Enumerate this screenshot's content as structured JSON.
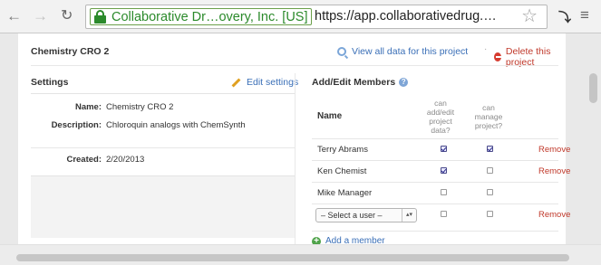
{
  "browser": {
    "ev_name": "Collaborative Dr…overy, Inc. [US]",
    "url": "https://app.collaborativedrug.…"
  },
  "page": {
    "project_title": "Chemistry CRO 2",
    "view_all_link": "View all data for this project",
    "delete_link": "Delete this project",
    "separator": "·"
  },
  "settings": {
    "title": "Settings",
    "edit_link": "Edit settings",
    "rows": [
      {
        "label": "Name:",
        "value": "Chemistry CRO 2"
      },
      {
        "label": "Description:",
        "value": "Chloroquin analogs with ChemSynth"
      },
      {
        "label": "Created:",
        "value": "2/20/2013"
      }
    ]
  },
  "members": {
    "title": "Add/Edit Members",
    "help_glyph": "?",
    "col_name": "Name",
    "col_edit_lines": [
      "can",
      "add/edit",
      "project",
      "data?"
    ],
    "col_manage_lines": [
      "can",
      "manage",
      "project?"
    ],
    "rows": [
      {
        "name": "Terry Abrams",
        "can_edit": true,
        "can_manage": true,
        "remove": "Remove"
      },
      {
        "name": "Ken Chemist",
        "can_edit": true,
        "can_manage": false,
        "remove": "Remove"
      },
      {
        "name": "Mike Manager",
        "can_edit": false,
        "can_manage": false,
        "remove": ""
      }
    ],
    "select_row": {
      "placeholder": "– Select a user –",
      "can_edit": false,
      "can_manage": false,
      "remove": "Remove"
    },
    "add_member": "Add a member",
    "add_glyph": "+"
  },
  "icons": {
    "back": "←",
    "forward": "→",
    "reload": "↻",
    "star": "☆",
    "menu": "≡",
    "extension": "⤵",
    "select_arrows": "▴▾"
  },
  "colors": {
    "link": "#3a6fb7",
    "danger": "#c0392b",
    "ev_green": "#2b8a2b"
  }
}
